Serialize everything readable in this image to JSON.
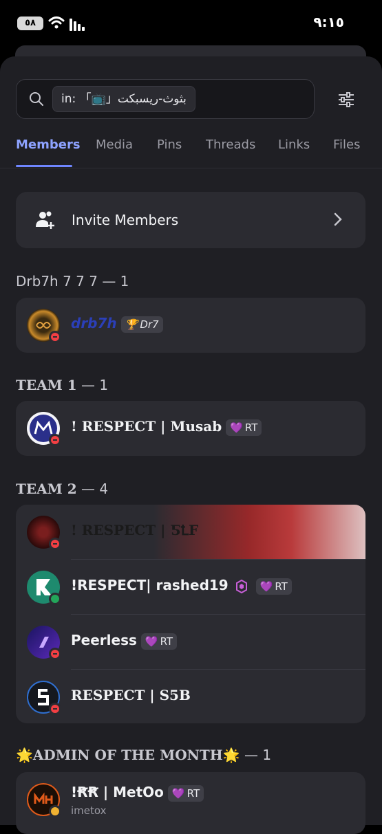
{
  "status_bar": {
    "time": "٩:١٥",
    "battery": "٥٨"
  },
  "search": {
    "scope_prefix": "in:",
    "channel": "「📺」بثوث-ريسبكت"
  },
  "tabs": [
    "Members",
    "Media",
    "Pins",
    "Threads",
    "Links",
    "Files"
  ],
  "active_tab": "Members",
  "invite": {
    "label": "Invite Members"
  },
  "sections": [
    {
      "name": "Drb7h 7 7 7",
      "count": "— 1",
      "members": [
        {
          "name": "drb7h",
          "badge": "Dr7",
          "badge_icon": "🏆",
          "status": "dnd"
        }
      ]
    },
    {
      "name": "TEAM 1",
      "count": "— 1",
      "members": [
        {
          "name": "! RESPECT | Musab",
          "badge": "RT",
          "badge_icon": "💜",
          "status": "dnd"
        }
      ]
    },
    {
      "name": "TEAM 2",
      "count": "— 4",
      "members": [
        {
          "name": "! RESPECT | ƼꝈF",
          "status": "dnd"
        },
        {
          "name": "!RESPECT| rashed19",
          "extra_icon": "hexagon-badge-icon",
          "badge": "RT",
          "badge_icon": "💜",
          "status": "online"
        },
        {
          "name": "Peerless",
          "badge": "RT",
          "badge_icon": "💜",
          "status": "dnd"
        },
        {
          "name": "RESPECT | S5B",
          "status": "dnd"
        }
      ]
    },
    {
      "name": "ADMIN OF THE MONTH",
      "name_icon": "🌟",
      "count": "— 1",
      "members": [
        {
          "name": "!ꞦꞦ | MetOo",
          "badge": "RT",
          "badge_icon": "💜",
          "subtitle": "imetox",
          "status": "idle"
        }
      ]
    }
  ],
  "colors": {
    "accent": "#8da2ff",
    "background": "#1f1f24",
    "card": "#2b2b31",
    "dnd": "#f23f43",
    "online": "#23a55a",
    "idle": "#f0b232"
  }
}
